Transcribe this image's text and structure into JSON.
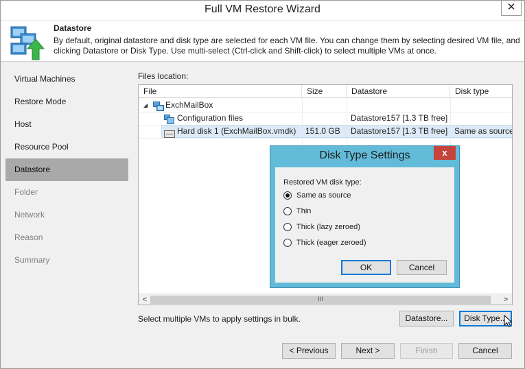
{
  "window": {
    "title": "Full VM Restore Wizard",
    "close_glyph": "✕"
  },
  "header": {
    "title": "Datastore",
    "description": "By default, original datastore and disk type are selected for each VM file. You can change them by selecting desired VM file, and clicking Datastore or Disk Type. Use multi-select (Ctrl-click and Shift-click) to select multiple VMs at once."
  },
  "nav": {
    "items": [
      {
        "label": "Virtual Machines",
        "state": "normal"
      },
      {
        "label": "Restore Mode",
        "state": "normal"
      },
      {
        "label": "Host",
        "state": "normal"
      },
      {
        "label": "Resource Pool",
        "state": "normal"
      },
      {
        "label": "Datastore",
        "state": "active"
      },
      {
        "label": "Folder",
        "state": "disabled"
      },
      {
        "label": "Network",
        "state": "disabled"
      },
      {
        "label": "Reason",
        "state": "disabled"
      },
      {
        "label": "Summary",
        "state": "disabled"
      }
    ]
  },
  "files": {
    "label": "Files location:",
    "columns": [
      "File",
      "Size",
      "Datastore",
      "Disk type"
    ],
    "rows": [
      {
        "file": "ExchMailBox",
        "size": "",
        "datastore": "",
        "disk_type": "",
        "icon": "vm-icon",
        "expander": "◢"
      },
      {
        "file": "Configuration files",
        "size": "",
        "datastore": "Datastore157 [1.3 TB free]",
        "disk_type": "",
        "icon": "config-files-icon"
      },
      {
        "file": "Hard disk 1 (ExchMailBox.vmdk)",
        "size": "151.0 GB",
        "datastore": "Datastore157 [1.3 TB free]",
        "disk_type": "Same as source",
        "icon": "hard-disk-icon",
        "selected": true
      }
    ],
    "scroll": {
      "left": "<",
      "right": ">",
      "grip": "III"
    }
  },
  "bulk_hint": "Select multiple VMs to apply settings in bulk.",
  "buttons": {
    "datastore": "Datastore...",
    "disk_type": "Disk Type...",
    "previous": "< Previous",
    "next": "Next >",
    "finish": "Finish",
    "cancel": "Cancel"
  },
  "dialog": {
    "title": "Disk Type Settings",
    "close_glyph": "x",
    "label": "Restored VM disk type:",
    "options": [
      {
        "label": "Same as source",
        "checked": true
      },
      {
        "label": "Thin",
        "checked": false
      },
      {
        "label": "Thick (lazy zeroed)",
        "checked": false
      },
      {
        "label": "Thick (eager zeroed)",
        "checked": false
      }
    ],
    "ok": "OK",
    "cancel": "Cancel"
  },
  "colors": {
    "dialog_frame": "#62bbd8",
    "dialog_close": "#c7443a",
    "nav_active": "#a9a9a9",
    "selection": "#dceaf7",
    "focus": "#0078d7"
  }
}
